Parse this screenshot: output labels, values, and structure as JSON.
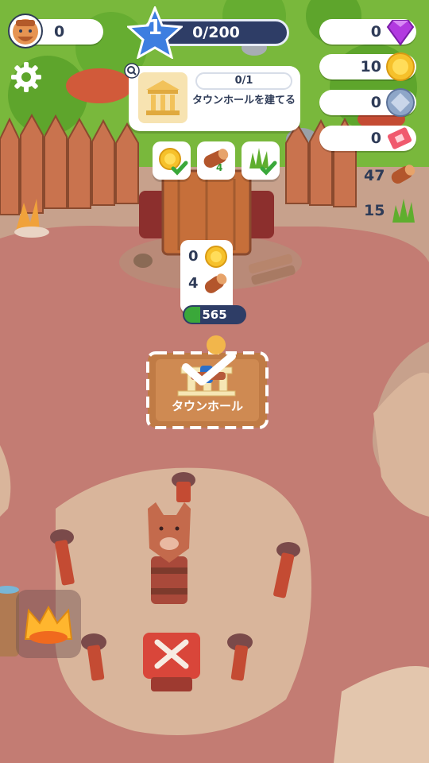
{
  "hud": {
    "population": "0",
    "level": "1",
    "xp": "0/200"
  },
  "resources": {
    "gems": "0",
    "coins": "10",
    "shields": "0",
    "tickets": "0",
    "wood": "47",
    "grass": "15"
  },
  "quest": {
    "progress": "0/1",
    "title": "タウンホールを建てる"
  },
  "requirements": {
    "wood_count": "4"
  },
  "build_cost": {
    "coins": "0",
    "wood": "4"
  },
  "player": {
    "hp": "565"
  },
  "plot": {
    "label": "タウンホール"
  },
  "colors": {
    "ground": "#c98f7e",
    "path": "#c17a72",
    "hud_dark": "#2e3d66",
    "grass": "#7fbf3f"
  }
}
